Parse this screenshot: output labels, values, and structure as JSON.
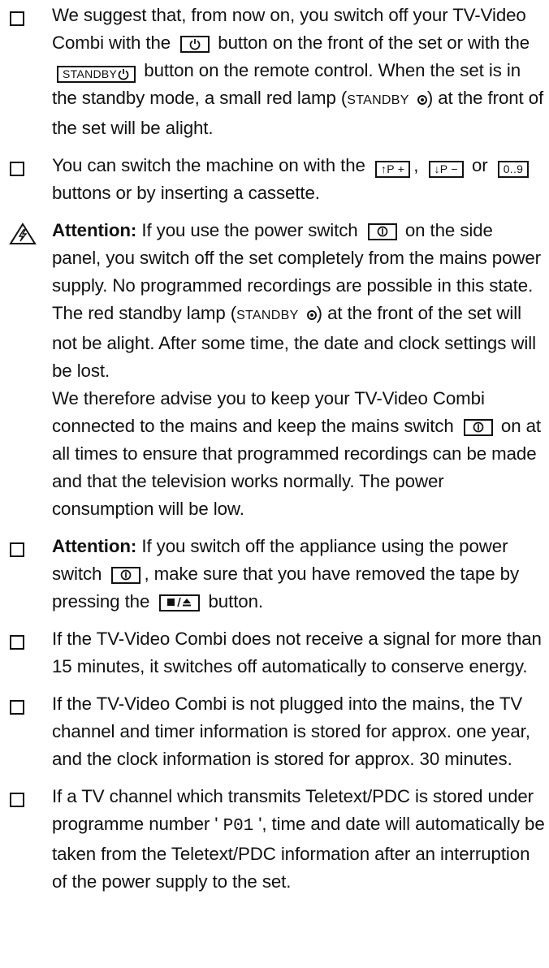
{
  "items": [
    {
      "bullet_icon": "checkbox-icon",
      "paragraphs": [
        {
          "parts": [
            {
              "type": "text",
              "value": "We suggest that, from now on, you switch off your TV-Video Combi with the"
            },
            {
              "type": "key",
              "icon": "power-icon"
            },
            {
              "type": "text",
              "value": "button on the front of the set or with the"
            },
            {
              "type": "key",
              "label": "STANDBY",
              "icon": "power-icon"
            },
            {
              "type": "text",
              "value": "button on the remote control. When the set is in the standby mode, a small red lamp ("
            },
            {
              "type": "smallcaps",
              "value": "STANDBY"
            },
            {
              "type": "lamp",
              "icon": "standby-lamp-icon"
            },
            {
              "type": "text",
              "value": ") at the front of the set will be alight."
            }
          ]
        }
      ]
    },
    {
      "bullet_icon": "checkbox-icon",
      "paragraphs": [
        {
          "parts": [
            {
              "type": "text",
              "value": "You can switch the machine on with the"
            },
            {
              "type": "key",
              "label": "↑P +",
              "icon": "program-up-icon"
            },
            {
              "type": "text",
              "value": ","
            },
            {
              "type": "key",
              "label": "↓P −",
              "icon": "program-down-icon"
            },
            {
              "type": "text",
              "value": "or"
            },
            {
              "type": "key",
              "label": "0..9",
              "icon": "digit-keys-icon"
            },
            {
              "type": "text",
              "value": "buttons or by inserting a cassette."
            }
          ]
        }
      ]
    },
    {
      "bullet_icon": "warning-icon",
      "paragraphs": [
        {
          "parts": [
            {
              "type": "strong",
              "value": "Attention:"
            },
            {
              "type": "text",
              "value": "If you use the power switch"
            },
            {
              "type": "key",
              "icon": "mains-switch-icon"
            },
            {
              "type": "text",
              "value": "on the side panel, you switch off the set completely from the mains power supply. No programmed recordings are possible in this state. The red standby lamp ("
            },
            {
              "type": "smallcaps",
              "value": "STANDBY"
            },
            {
              "type": "lamp",
              "icon": "standby-lamp-icon"
            },
            {
              "type": "text",
              "value": ") at the front of the set will not be alight. After some time, the date and clock settings will be lost."
            }
          ]
        },
        {
          "parts": [
            {
              "type": "text",
              "value": "We therefore advise you to keep your TV-Video Combi connected to the mains and keep the mains switch"
            },
            {
              "type": "key",
              "icon": "mains-switch-icon"
            },
            {
              "type": "text",
              "value": "on at all times to ensure that programmed recordings can be made and that the television works normally. The power consumption will be low."
            }
          ]
        }
      ]
    },
    {
      "bullet_icon": "checkbox-icon",
      "paragraphs": [
        {
          "parts": [
            {
              "type": "strong",
              "value": "Attention:"
            },
            {
              "type": "text",
              "value": "If you switch off the appliance using the power switch"
            },
            {
              "type": "key",
              "icon": "mains-switch-icon"
            },
            {
              "type": "text",
              "value": ", make sure that you have removed the tape by pressing the"
            },
            {
              "type": "key",
              "icon": "stop-eject-icon"
            },
            {
              "type": "text",
              "value": "button."
            }
          ]
        }
      ]
    },
    {
      "bullet_icon": "checkbox-icon",
      "paragraphs": [
        {
          "parts": [
            {
              "type": "text",
              "value": "If the TV-Video Combi does not receive a signal for more than 15 minutes, it switches off automatically to conserve energy."
            }
          ]
        }
      ]
    },
    {
      "bullet_icon": "checkbox-icon",
      "paragraphs": [
        {
          "parts": [
            {
              "type": "text",
              "value": "If the TV-Video Combi is not plugged into the mains, the TV channel and timer information is stored for approx. one year, and the clock information is stored for approx. 30 minutes."
            }
          ]
        }
      ]
    },
    {
      "bullet_icon": "checkbox-icon",
      "paragraphs": [
        {
          "parts": [
            {
              "type": "text",
              "value": "If a TV channel which transmits Teletext/PDC is stored under programme number '"
            },
            {
              "type": "mono",
              "value": "P01"
            },
            {
              "type": "text",
              "value": "', time and date will automatically be taken from the Teletext/PDC information after an interruption of the power supply to the set."
            }
          ]
        }
      ]
    }
  ]
}
